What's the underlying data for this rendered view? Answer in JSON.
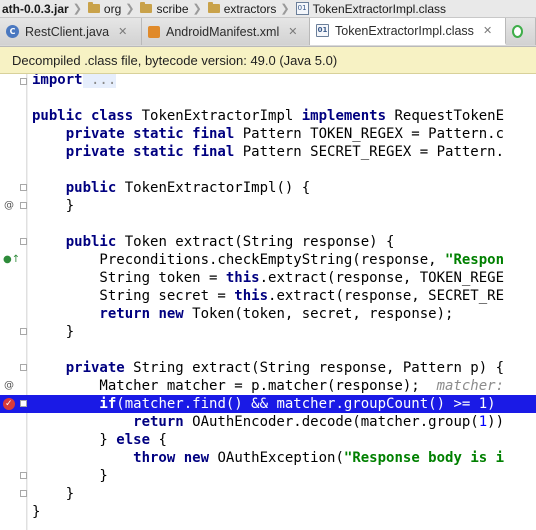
{
  "breadcrumb": {
    "items": [
      {
        "label": "ath-0.0.3.jar",
        "icon": "none"
      },
      {
        "label": "org",
        "icon": "folder-icon"
      },
      {
        "label": "scribe",
        "icon": "folder-icon"
      },
      {
        "label": "extractors",
        "icon": "folder-icon"
      },
      {
        "label": "TokenExtractorImpl.class",
        "icon": "class-file-icon",
        "badge": "01"
      }
    ]
  },
  "tabs": [
    {
      "label": "RestClient.java",
      "icon": "java-class-icon",
      "glyph": "C",
      "close": "✕",
      "active": false
    },
    {
      "label": "AndroidManifest.xml",
      "icon": "xml-file-icon",
      "glyph": "",
      "close": "✕",
      "active": false
    },
    {
      "label": "TokenExtractorImpl.class",
      "icon": "class-file-icon",
      "glyph": "01",
      "close": "✕",
      "active": true
    },
    {
      "label": "",
      "icon": "refresh-icon",
      "glyph": "",
      "close": "",
      "active": false
    }
  ],
  "banner": {
    "text": "Decompiled .class file, bytecode version: 49.0 (Java 5.0)"
  },
  "code": {
    "l0": {
      "kw": "import",
      "fold": " ..."
    },
    "l1": "",
    "l2": {
      "kw1": "public class",
      "t1": " TokenExtractorImpl ",
      "kw2": "implements",
      "t2": " RequestTokenE"
    },
    "l3": {
      "kw": "    private static final",
      "t": " Pattern TOKEN_REGEX = Pattern.c"
    },
    "l4": {
      "kw": "    private static final",
      "t": " Pattern SECRET_REGEX = Pattern."
    },
    "l5": "",
    "l6": {
      "kw": "    public",
      "t": " TokenExtractorImpl() {"
    },
    "l7": "    }",
    "l8": "",
    "l9": {
      "kw": "    public",
      "t": " Token extract(String response) {"
    },
    "l10": {
      "t": "        Preconditions.checkEmptyString(response, ",
      "s": "\"Respon"
    },
    "l11": {
      "t1": "        String token = ",
      "kw": "this",
      "t2": ".extract(response, TOKEN_REGE"
    },
    "l12": {
      "t1": "        String secret = ",
      "kw": "this",
      "t2": ".extract(response, SECRET_RE"
    },
    "l13": {
      "kw1": "        return",
      "sp": " ",
      "kw2": "new",
      "t": " Token(token, secret, response);"
    },
    "l14": "    }",
    "l15": "",
    "l16": {
      "kw": "    private",
      "t": " String extract(String response, Pattern p) {"
    },
    "l17": {
      "t": "        Matcher matcher = p.matcher(response);  ",
      "hint": "matcher:"
    },
    "l18": {
      "kw": "        if",
      "t": "(matcher.find() && matcher.groupCount() >= ",
      "n": "1",
      "t2": ")"
    },
    "l19": {
      "kw": "            return",
      "t": " OAuthEncoder.decode(matcher.group(",
      "n": "1",
      "t2": "))"
    },
    "l20": {
      "t1": "        } ",
      "kw": "else",
      "t2": " {"
    },
    "l21": {
      "kw1": "            throw",
      "sp": " ",
      "kw2": "new",
      "t": " OAuthException(",
      "s": "\"Response body is i"
    },
    "l22": "        }",
    "l23": "    }",
    "l24": "}"
  },
  "gutter": {
    "override_marker": "@",
    "implements_marker": "●↑",
    "breakpoint": "breakpoint-icon"
  },
  "colors": {
    "keyword": "#000080",
    "string": "#008000",
    "number": "#0000ff",
    "selection": "#1a1ae6",
    "banner": "#f7f2c4"
  }
}
